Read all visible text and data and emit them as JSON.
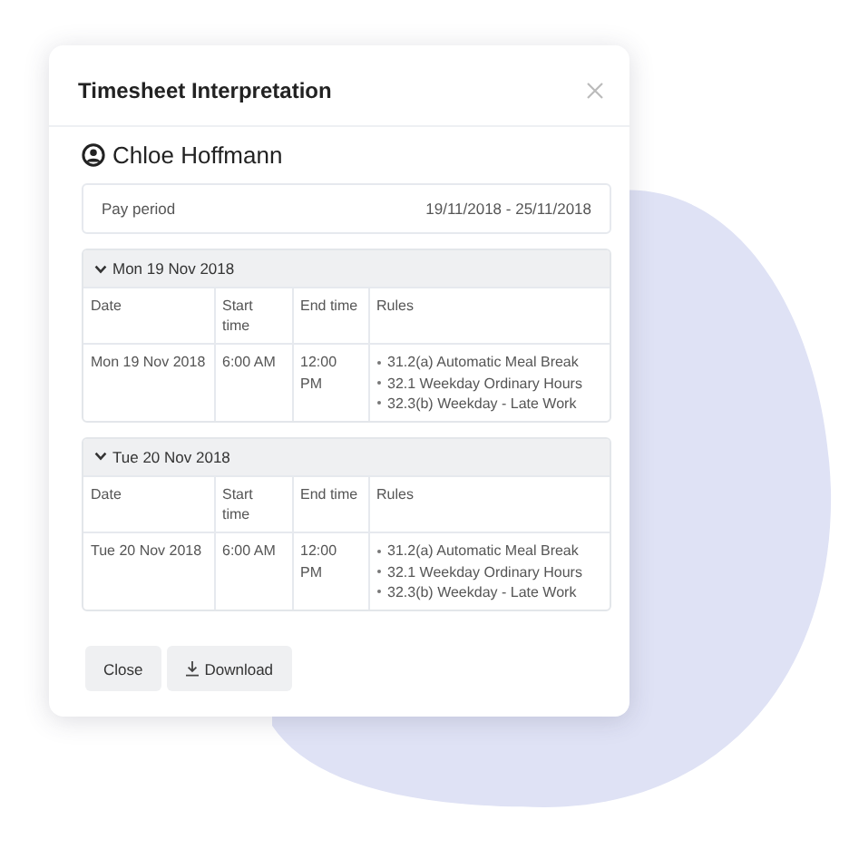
{
  "dialog": {
    "title": "Timesheet Interpretation",
    "employee": "Chloe Hoffmann",
    "pay_period": {
      "label": "Pay period",
      "value": "19/11/2018 - 25/11/2018"
    },
    "days": [
      {
        "heading": "Mon 19 Nov 2018",
        "expanded": true,
        "columns": [
          "Date",
          "Start time",
          "End time",
          "Rules"
        ],
        "rows": [
          {
            "date": "Mon 19 Nov 2018",
            "start": "6:00 AM",
            "end": "12:00 PM",
            "rules": [
              "31.2(a) Automatic Meal Break",
              "32.1 Weekday Ordinary Hours",
              "32.3(b) Weekday - Late Work"
            ]
          }
        ]
      },
      {
        "heading": "Tue 20 Nov 2018",
        "expanded": true,
        "columns": [
          "Date",
          "Start time",
          "End time",
          "Rules"
        ],
        "rows": [
          {
            "date": "Tue 20 Nov 2018",
            "start": "6:00 AM",
            "end": "12:00 PM",
            "rules": [
              "31.2(a) Automatic Meal Break",
              "32.1 Weekday Ordinary Hours",
              "32.3(b) Weekday - Late Work"
            ]
          }
        ]
      }
    ],
    "buttons": [
      {
        "label": "Close",
        "kind": "plain"
      },
      {
        "label": "Download",
        "kind": "download"
      }
    ]
  }
}
